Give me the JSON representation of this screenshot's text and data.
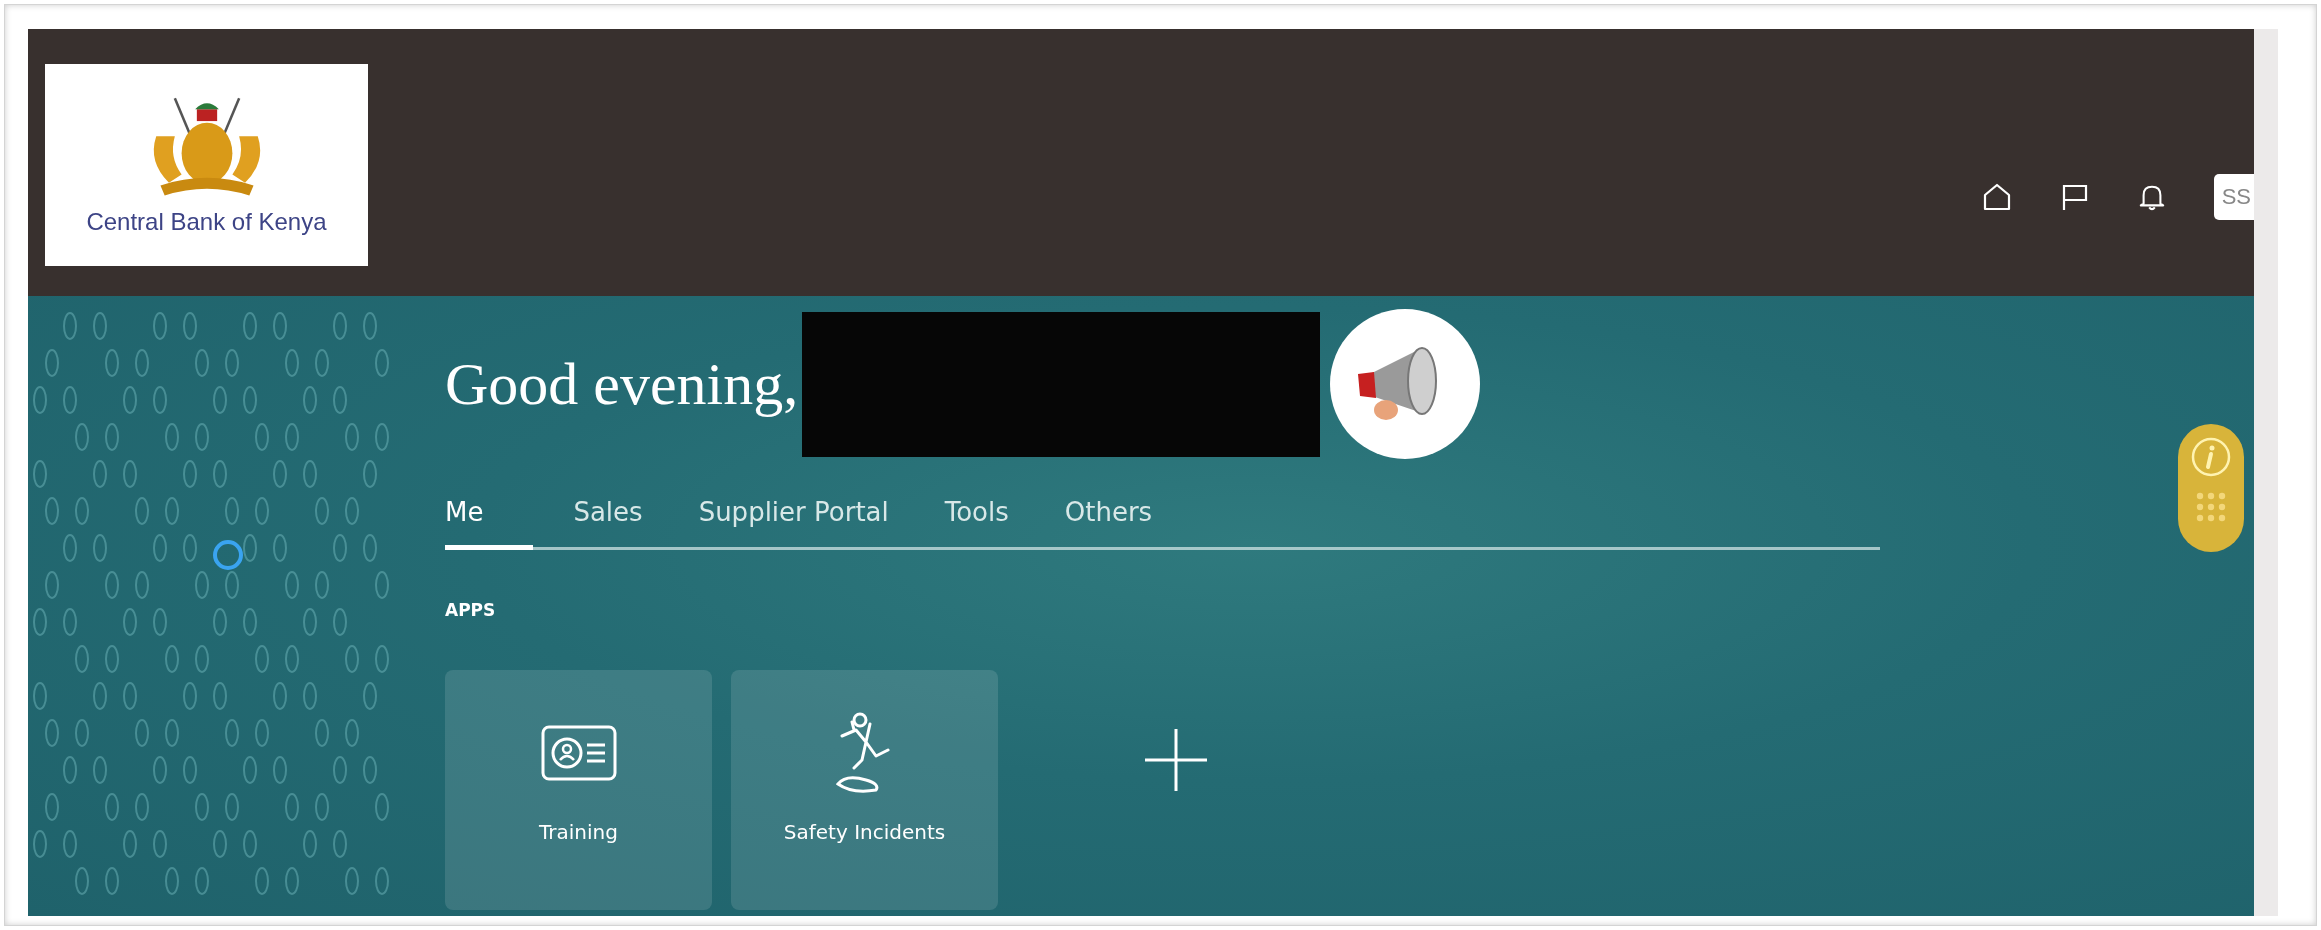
{
  "header": {
    "logo_text": "Central Bank of Kenya",
    "user_badge": "SS"
  },
  "greeting": "Good evening,",
  "tabs": [
    {
      "label": "Me",
      "selected": true
    },
    {
      "label": "Sales",
      "selected": false
    },
    {
      "label": "Supplier Portal",
      "selected": false
    },
    {
      "label": "Tools",
      "selected": false
    },
    {
      "label": "Others",
      "selected": false
    }
  ],
  "section_title": "APPS",
  "apps": [
    {
      "label": "Training",
      "kind": "id-card"
    },
    {
      "label": "Safety Incidents",
      "kind": "fall"
    }
  ]
}
